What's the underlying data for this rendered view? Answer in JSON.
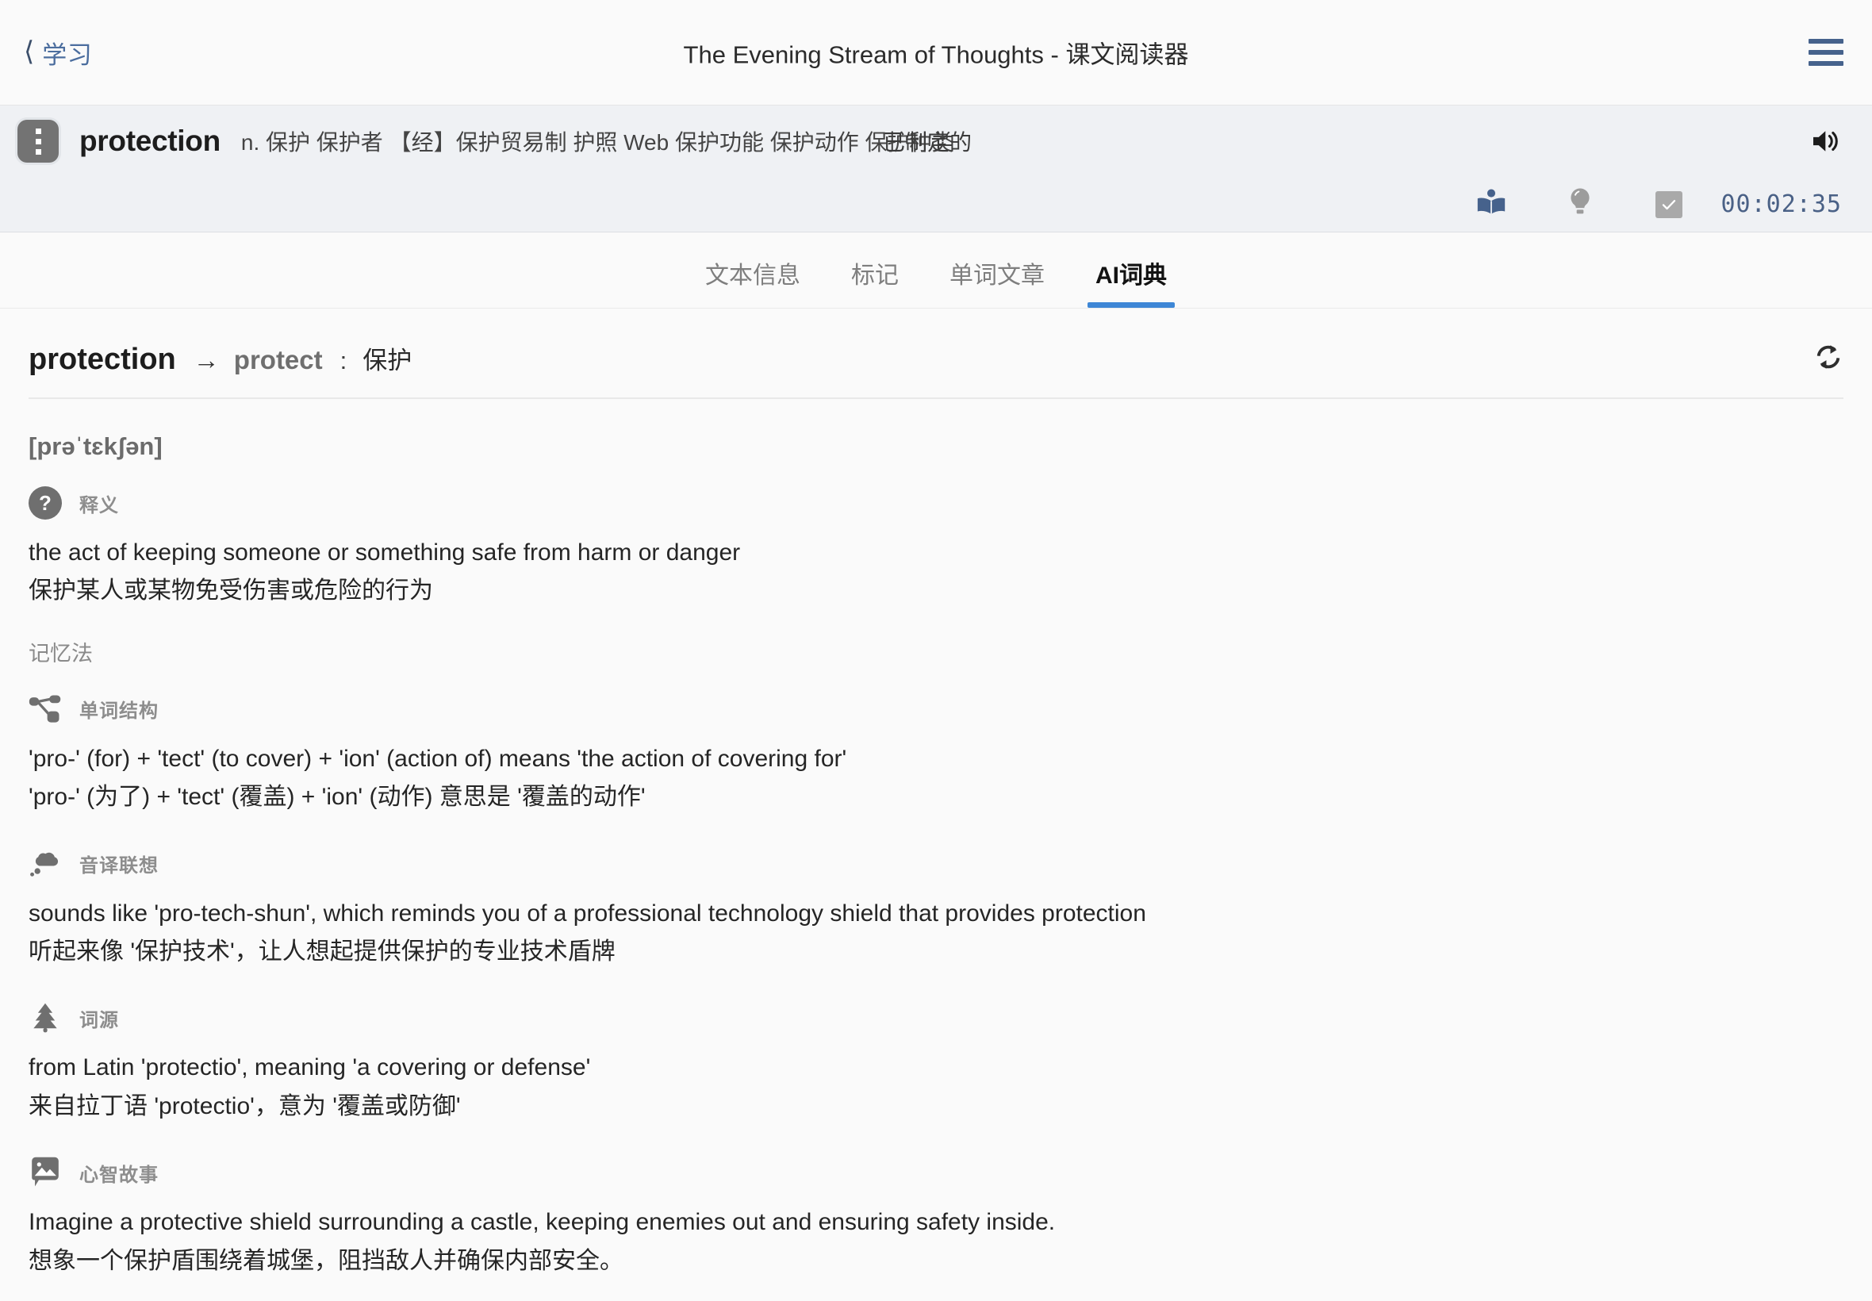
{
  "navbar": {
    "back_label": "学习",
    "back_icon": "chevron-left-icon",
    "title": "The Evening Stream of Thoughts - 课文阅读器",
    "menu_icon": "hamburger-menu-icon"
  },
  "word_bar": {
    "drag_icon": "more-vertical-dots-icon",
    "word": "protection",
    "senses": "n. 保护 保护者 【经】保护贸易制 护照 Web 保护功能 保护动作 保护种类",
    "translation": "已制定的",
    "speaker_icon": "volume-speaker-icon"
  },
  "tools_bar": {
    "items": [
      {
        "icon": "open-book-icon",
        "name": "reading-mode-button"
      },
      {
        "icon": "lightbulb-icon",
        "name": "hint-button"
      },
      {
        "icon": "checkbox-checked-icon",
        "name": "mark-done-checkbox"
      }
    ],
    "timer": "00:02:35"
  },
  "tabs": {
    "items": [
      {
        "label": "文本信息",
        "active": false
      },
      {
        "label": "标记",
        "active": false
      },
      {
        "label": "单词文章",
        "active": false
      },
      {
        "label": "AI词典",
        "active": true
      }
    ],
    "active_color": "#3e87d6"
  },
  "entry": {
    "word": "protection",
    "arrow": "→",
    "root": "protect",
    "colon": ":",
    "root_zh": "保护",
    "refresh_icon": "refresh-sync-icon",
    "phonetic": "[prəˈtɛkʃən]"
  },
  "sections": {
    "definition": {
      "icon": "question-mark-circle-icon",
      "label": "释义",
      "en": "the act of keeping someone or something safe from harm or danger",
      "zh": "保护某人或某物免受伤害或危险的行为"
    },
    "mnemonic_heading": "记忆法",
    "structure": {
      "icon": "node-tree-icon",
      "label": "单词结构",
      "en": "'pro-' (for) + 'tect' (to cover) + 'ion' (action of) means 'the action of covering for'",
      "zh": "'pro-' (为了) + 'tect' (覆盖) + 'ion' (动作) 意思是 '覆盖的动作'"
    },
    "sound_association": {
      "icon": "thought-cloud-icon",
      "label": "音译联想",
      "en": "sounds like 'pro-tech-shun', which reminds you of a professional technology shield that provides protection",
      "zh": "听起来像 '保护技术'，让人想起提供保护的专业技术盾牌"
    },
    "etymology": {
      "icon": "pine-tree-icon",
      "label": "词源",
      "en": "from Latin 'protectio', meaning 'a covering or defense'",
      "zh": "来自拉丁语 'protectio'，意为 '覆盖或防御'"
    },
    "mind_story": {
      "icon": "image-bubble-icon",
      "label": "心智故事",
      "en": "Imagine a protective shield surrounding a castle, keeping enemies out and ensuring safety inside.",
      "zh": "想象一个保护盾围绕着城堡，阻挡敌人并确保内部安全。"
    }
  }
}
